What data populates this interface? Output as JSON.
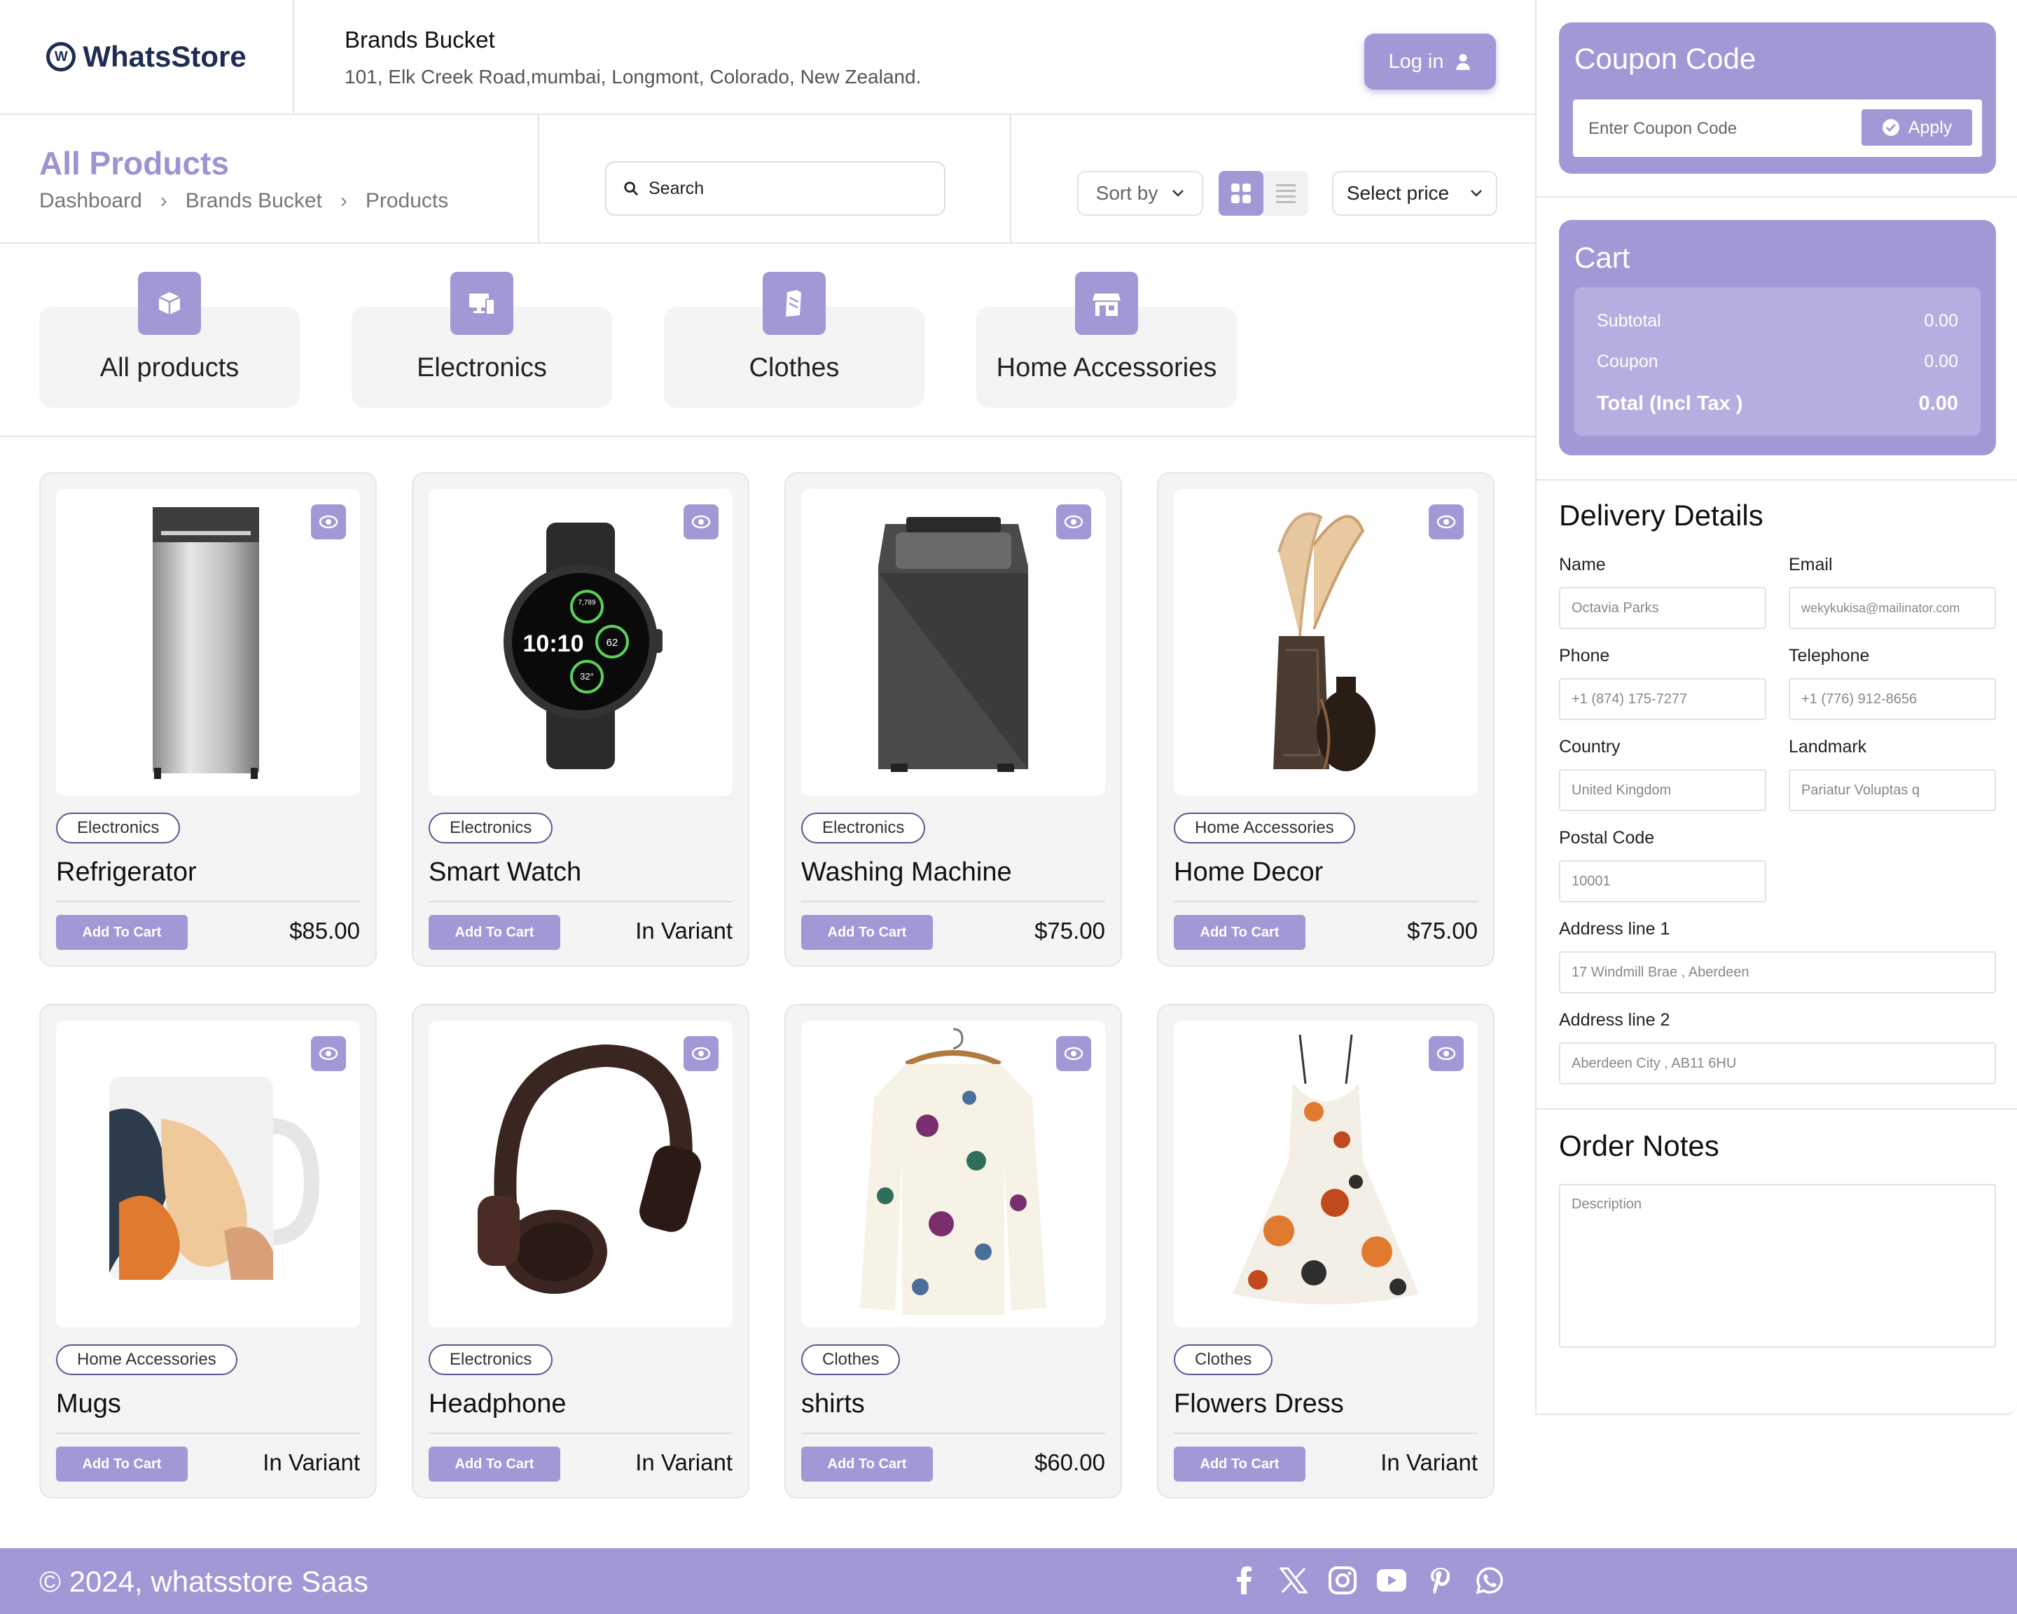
{
  "brand": {
    "name": "WhatsStore",
    "logo_glyph": "W"
  },
  "store": {
    "name": "Brands Bucket",
    "address": "101, Elk Creek Road,mumbai, Longmont, Colorado, New Zealand."
  },
  "header": {
    "login_label": "Log in"
  },
  "page": {
    "title": "All Products",
    "breadcrumb": [
      "Dashboard",
      "Brands Bucket",
      "Products"
    ]
  },
  "search": {
    "placeholder": "Search"
  },
  "toolbar": {
    "sort_label": "Sort by",
    "price_label": "Select price",
    "view_mode": "grid"
  },
  "categories": [
    {
      "label": "All products",
      "icon": "box-icon"
    },
    {
      "label": "Electronics",
      "icon": "devices-icon"
    },
    {
      "label": "Clothes",
      "icon": "tag-icon"
    },
    {
      "label": "Home Accessories",
      "icon": "store-icon"
    }
  ],
  "products": [
    {
      "name": "Refrigerator",
      "category": "Electronics",
      "price": "$85.00",
      "button": "Add To Cart",
      "image": "refrigerator"
    },
    {
      "name": "Smart Watch",
      "category": "Electronics",
      "price": "In Variant",
      "button": "Add To Cart",
      "image": "smart-watch"
    },
    {
      "name": "Washing Machine",
      "category": "Electronics",
      "price": "$75.00",
      "button": "Add To Cart",
      "image": "washing-machine"
    },
    {
      "name": "Home Decor",
      "category": "Home Accessories",
      "price": "$75.00",
      "button": "Add To Cart",
      "image": "vases"
    },
    {
      "name": "Mugs",
      "category": "Home Accessories",
      "price": "In Variant",
      "button": "Add To Cart",
      "image": "mug"
    },
    {
      "name": "Headphone",
      "category": "Electronics",
      "price": "In Variant",
      "button": "Add To Cart",
      "image": "headphone"
    },
    {
      "name": "shirts",
      "category": "Clothes",
      "price": "$60.00",
      "button": "Add To Cart",
      "image": "shirt"
    },
    {
      "name": "Flowers Dress",
      "category": "Clothes",
      "price": "In Variant",
      "button": "Add To Cart",
      "image": "dress"
    }
  ],
  "watch_face": {
    "time": "10:10",
    "steps": "7,789",
    "heart": "62",
    "temp": "32°"
  },
  "coupon": {
    "title": "Coupon Code",
    "placeholder": "Enter Coupon Code",
    "apply_label": "Apply"
  },
  "cart": {
    "title": "Cart",
    "rows": [
      {
        "label": "Subtotal",
        "value": "0.00"
      },
      {
        "label": "Coupon",
        "value": "0.00"
      },
      {
        "label": "Total (Incl Tax )",
        "value": "0.00"
      }
    ]
  },
  "delivery": {
    "title": "Delivery Details",
    "fields": {
      "name": {
        "label": "Name",
        "value": "Octavia Parks"
      },
      "email": {
        "label": "Email",
        "value": "wekykukisa@mailinator.com"
      },
      "phone": {
        "label": "Phone",
        "value": "+1 (874) 175-7277"
      },
      "telephone": {
        "label": "Telephone",
        "value": "+1 (776) 912-8656"
      },
      "country": {
        "label": "Country",
        "value": "United Kingdom"
      },
      "landmark": {
        "label": "Landmark",
        "value": "Pariatur Voluptas q"
      },
      "postal": {
        "label": "Postal Code",
        "value": "10001"
      },
      "address1": {
        "label": "Address line 1",
        "value": "17 Windmill Brae , Aberdeen"
      },
      "address2": {
        "label": "Address line 2",
        "value": "Aberdeen City , AB11 6HU"
      }
    }
  },
  "notes": {
    "title": "Order Notes",
    "placeholder": "Description"
  },
  "footer": {
    "copyright": "© 2024, whatsstore Saas",
    "socials": [
      "facebook-icon",
      "x-icon",
      "instagram-icon",
      "youtube-icon",
      "pinterest-icon",
      "whatsapp-icon"
    ]
  },
  "colors": {
    "accent": "#a298d6",
    "accent_light": "#b6aee0",
    "title": "#9d93d2",
    "logo": "#1f2d52"
  }
}
